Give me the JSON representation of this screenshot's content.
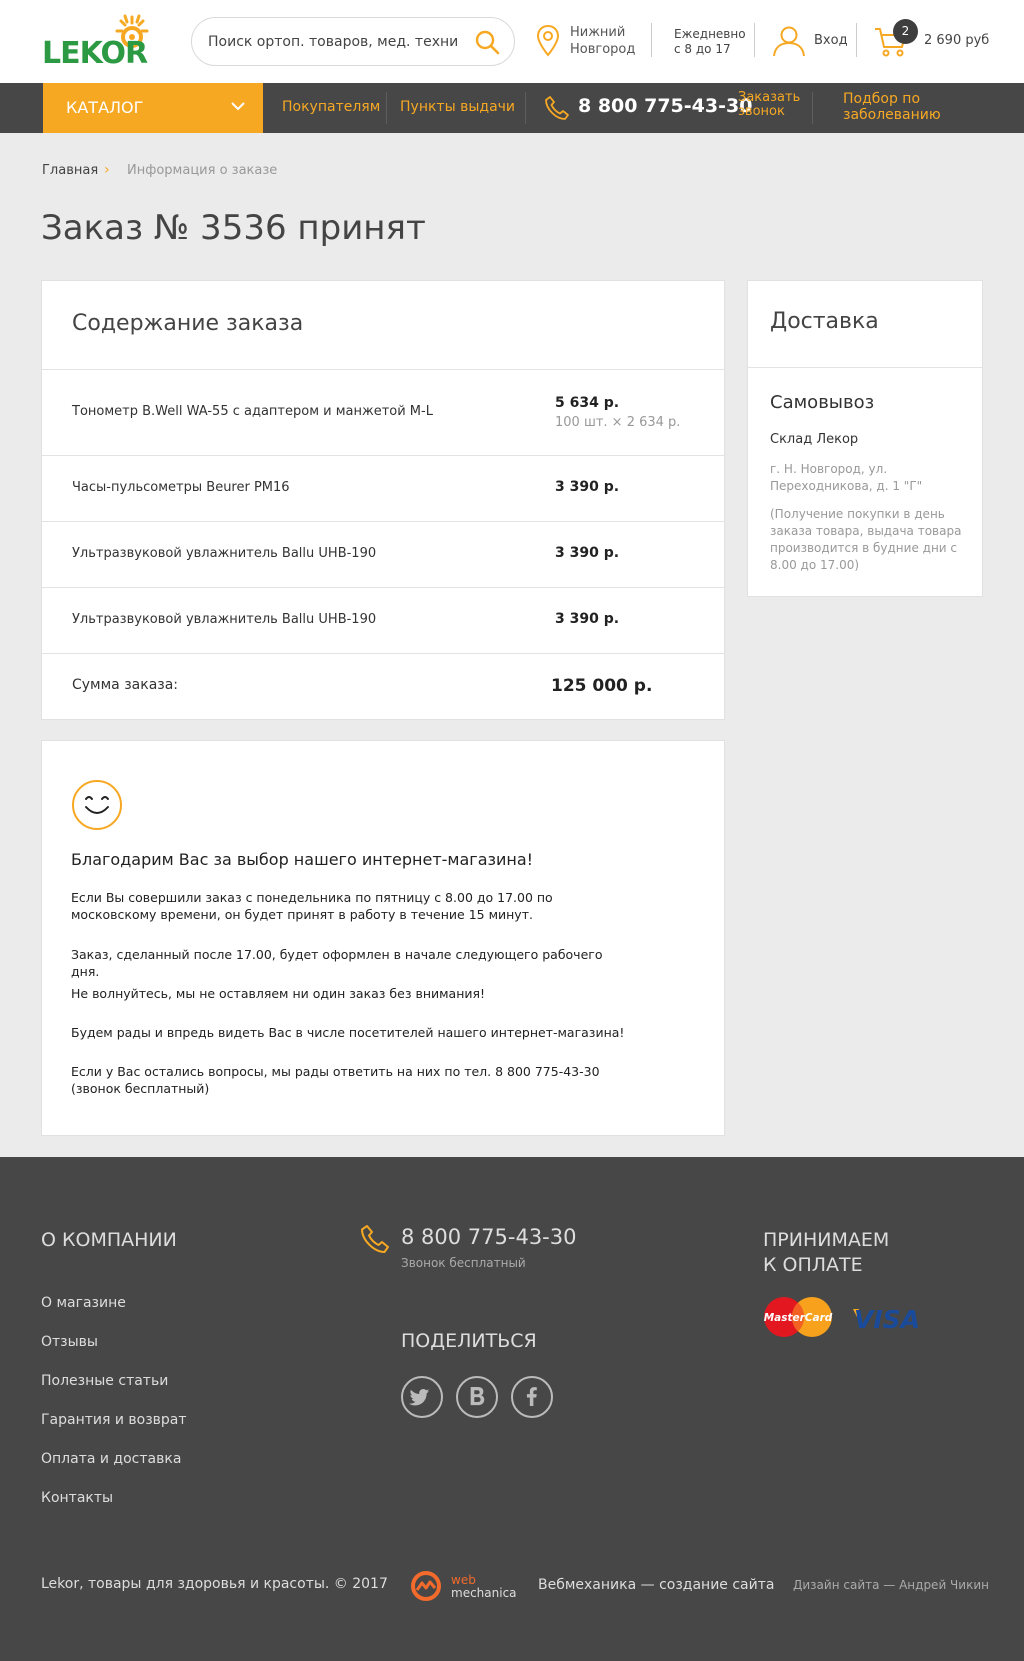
{
  "header": {
    "logo_text": "LEKOR",
    "search_placeholder": "Поиск ортоп. товаров, мед. техники",
    "city_line1": "Нижний",
    "city_line2": "Новгород",
    "hours_line1": "Ежедневно",
    "hours_line2": "с 8 до 17",
    "login_label": "Вход",
    "cart_count": "2",
    "cart_sum": "2 690 руб"
  },
  "nav": {
    "catalog_label": "КАТАЛОГ",
    "buyers_label": "Покупателям",
    "pickup_label": "Пункты выдачи",
    "phone": "8 800 775-43-30",
    "callback_line1": "Заказать",
    "callback_line2": "звонок",
    "pick_line1": "Подбор по",
    "pick_line2": "заболеванию"
  },
  "breadcrumb": {
    "home": "Главная",
    "separator": "›",
    "current": "Информация о заказе"
  },
  "page_title": "Заказ № 3536 принят",
  "order": {
    "heading": "Содержание заказа",
    "items": [
      {
        "name": "Тонометр B.Well WA-55 с адаптером и манжетой M-L",
        "price": "5 634 р.",
        "detail": "100 шт. × 2 634 р."
      },
      {
        "name": "Часы-пульсометры Beurer PM16",
        "price": "3 390 р."
      },
      {
        "name": "Ультразвуковой увлажнитель Ballu UHB-190",
        "price": "3 390 р."
      },
      {
        "name": "Ультразвуковой увлажнитель Ballu UHB-190",
        "price": "3 390 р."
      }
    ],
    "total_label": "Сумма заказа:",
    "total_value": "125 000 р."
  },
  "delivery": {
    "heading": "Доставка",
    "method": "Самовывоз",
    "store": "Склад Лекор",
    "address": "г. Н. Новгород, ул. Переходникова, д. 1 \"Г\"",
    "note": "(Получение покупки в день заказа товара, выдача товара производится в будние дни с 8.00 до 17.00)"
  },
  "thanks": {
    "heading": "Благодарим Вас за выбор нашего интернет-магазина!",
    "paragraphs": [
      "Если Вы совершили заказ с понедельника по пятницу с 8.00 до 17.00 по московскому времени, он будет принят в работу в течение 15 минут.",
      "Заказ, сделанный после 17.00, будет оформлен в начале следующего рабочего дня.",
      "Не волнуйтесь, мы не оставляем ни один заказ без внимания!",
      "Будем рады и впредь видеть Вас в числе посетителей нашего интернет-магазина!",
      "Если у Вас остались вопросы, мы рады ответить на них по тел. 8 800 775-43-30 (звонок бесплатный)"
    ]
  },
  "footer": {
    "about_heading": "О КОМПАНИИ",
    "links": [
      "О  магазине",
      "Отзывы",
      "Полезные статьи",
      "Гарантия и возврат",
      "Оплата и доставка",
      "Контакты"
    ],
    "phone": "8 800 775-43-30",
    "phone_note": "Звонок бесплатный",
    "share_heading": "ПОДЕЛИТЬСЯ",
    "pay_heading_line1": "ПРИНИМАЕМ",
    "pay_heading_line2": "К ОПЛАТЕ",
    "mastercard_label": "MasterCard",
    "visa_label": "VISA",
    "copyright": "Lekor, товары для здоровья и красоты. © 2017",
    "wm_logo_line1": "web",
    "wm_logo_line2": "mechanica",
    "wm_text": "Вебмеханика — создание сайта",
    "design_credit": "Дизайн сайта — Андрей Чикин"
  },
  "colors": {
    "accent": "#f7a823",
    "brand_green": "#2b9a43",
    "dark_bar": "#474747"
  }
}
